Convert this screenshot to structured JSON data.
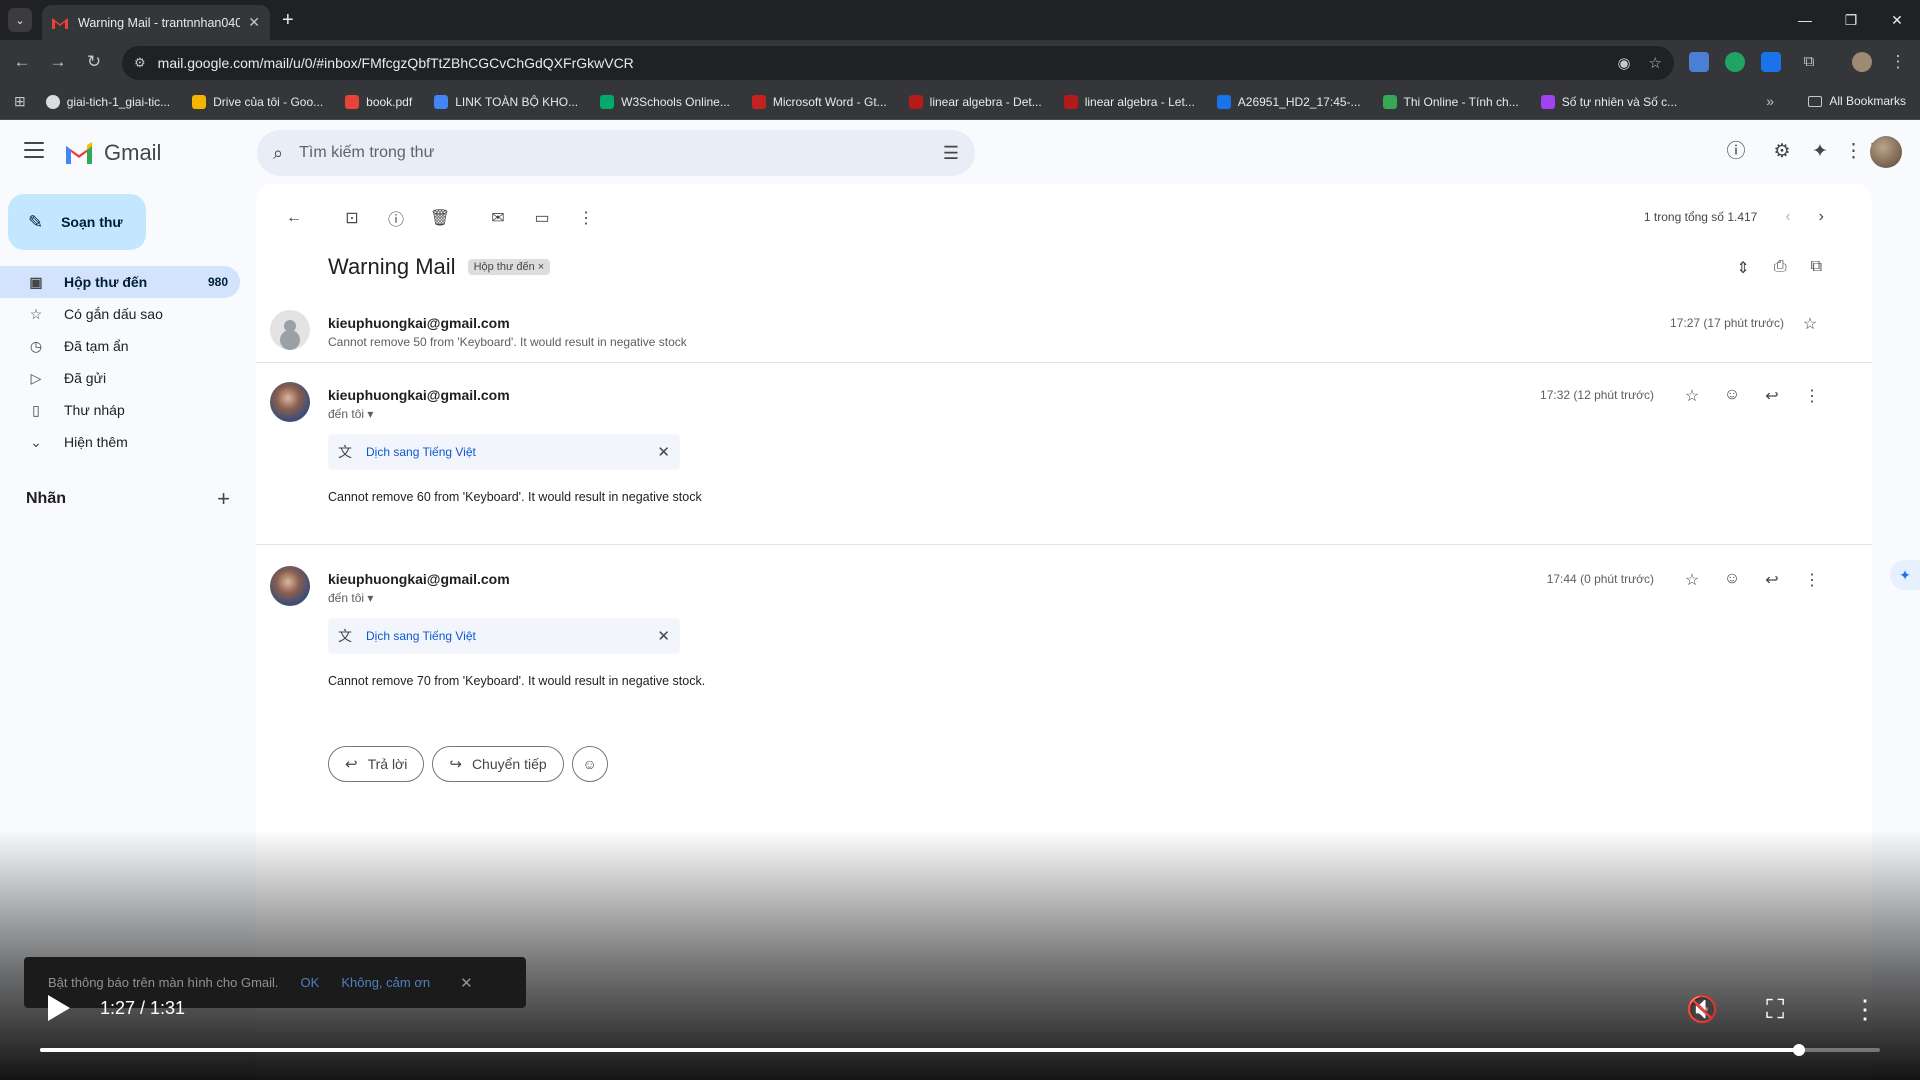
{
  "browser": {
    "tab_title": "Warning Mail - trantnnhan040",
    "url": "mail.google.com/mail/u/0/#inbox/FMfcgzQbfTtZBhCGCvChGdQXFrGkwVCR",
    "bookmarks": [
      {
        "label": "giai-tich-1_giai-tic...",
        "color": "#dadce0"
      },
      {
        "label": "Drive của tôi - Goo...",
        "color": "#f4b400"
      },
      {
        "label": "book.pdf",
        "color": "#ea4335"
      },
      {
        "label": "LINK TOÀN BỘ KHO...",
        "color": "#4285f4"
      },
      {
        "label": "W3Schools Online...",
        "color": "#04aa6d"
      },
      {
        "label": "Microsoft Word - Gt...",
        "color": "#c5221f"
      },
      {
        "label": "linear algebra - Det...",
        "color": "#b31b1b"
      },
      {
        "label": "linear algebra - Let...",
        "color": "#b31b1b"
      },
      {
        "label": "A26951_HD2_17:45-...",
        "color": "#1a73e8"
      },
      {
        "label": "Thi Online - Tính ch...",
        "color": "#34a853"
      },
      {
        "label": "Số tự nhiên và Số c...",
        "color": "#a142f4"
      }
    ],
    "all_bookmarks": "All Bookmarks"
  },
  "header": {
    "app_name": "Gmail",
    "search_placeholder": "Tìm kiếm trong thư"
  },
  "sidebar": {
    "compose_label": "Soạn thư",
    "items": [
      {
        "label": "Hộp thư đến",
        "count": "980",
        "icon": "inbox-icon"
      },
      {
        "label": "Có gắn dấu sao",
        "icon": "star-icon"
      },
      {
        "label": "Đã tạm ẩn",
        "icon": "clock-icon"
      },
      {
        "label": "Đã gửi",
        "icon": "send-icon"
      },
      {
        "label": "Thư nháp",
        "icon": "draft-icon"
      },
      {
        "label": "Hiện thêm",
        "icon": "chevron-down-icon"
      }
    ],
    "labels_title": "Nhãn"
  },
  "thread": {
    "pager": "1 trong tổng số 1.417",
    "subject": "Warning Mail",
    "label_chip": "Hộp thư đến",
    "messages": [
      {
        "sender": "kieuphuongkai@gmail.com",
        "snippet": "Cannot remove 50 from 'Keyboard'. It would result in negative stock",
        "time": "17:27 (17 phút trước)"
      },
      {
        "sender": "kieuphuongkai@gmail.com",
        "to": "đến tôi",
        "translate": "Dịch sang Tiếng Việt",
        "body": "Cannot remove 60 from 'Keyboard'. It would result in negative stock",
        "time": "17:32 (12 phút trước)"
      },
      {
        "sender": "kieuphuongkai@gmail.com",
        "to": "đến tôi",
        "translate": "Dịch sang Tiếng Việt",
        "body": "Cannot remove 70 from 'Keyboard'. It would result in negative stock.",
        "time": "17:44 (0 phút trước)"
      }
    ],
    "reply_label": "Trả lời",
    "forward_label": "Chuyển tiếp"
  },
  "snackbar": {
    "text": "Bật thông báo trên màn hình cho Gmail.",
    "ok": "OK",
    "no": "Không, cảm ơn"
  },
  "video": {
    "time": "1:27 / 1:31",
    "progress": 0.956
  }
}
